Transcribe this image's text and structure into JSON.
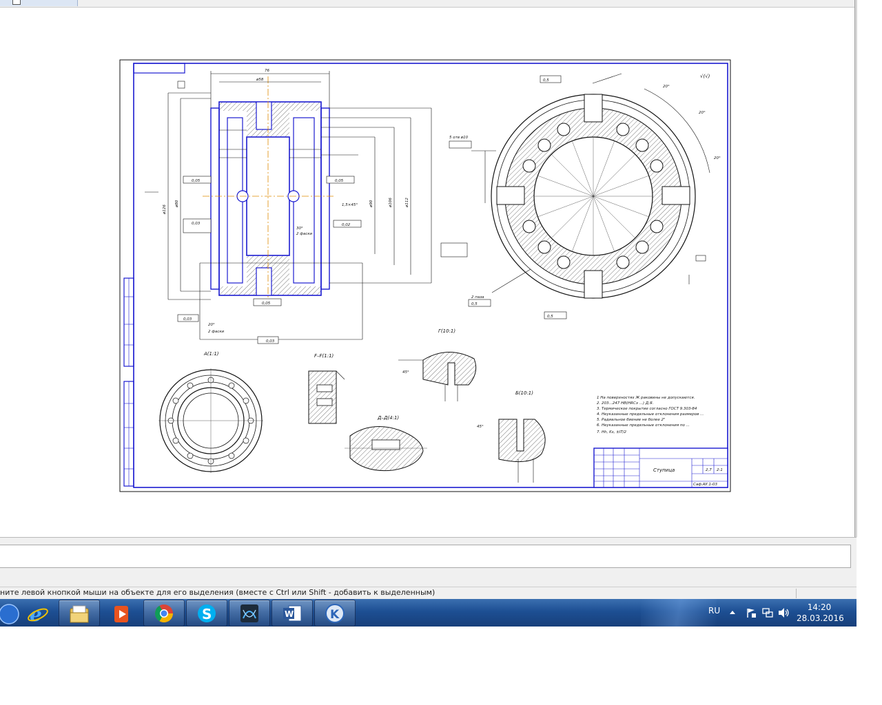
{
  "window": {
    "active_tab_icon": "document-icon"
  },
  "drawing": {
    "views": {
      "view_a": "А(1:1)",
      "section_f": "F–F(1:1)",
      "detail_g": "Г(10:1)",
      "section_d": "Д–Д(4:1)",
      "detail_b": "Б(10:1)",
      "roughness": "√(√)"
    },
    "notes": [
      "1 На поверхностях Ж раковины не допускаются.",
      "2. 203...247 НВ(НRCэ ...) Д.Я.",
      "3. Термическое покрытие согласно ГОСТ 9.303-84",
      "4. Неуказанные предельные отклонения размеров ...",
      "5. Радиальное биение не более 2\"",
      "6. Неуказанные предельные отклонения по ... ",
      "7. Hh, Ks, ±IT/2"
    ],
    "title_block": {
      "part_name": "Ступица",
      "designation": "Саф.АУ.1-03",
      "mass": "2,7",
      "scale": "2:1"
    },
    "dims": {
      "top_width": "76",
      "top_mid": "ø58",
      "d1": "ø126",
      "d2": "ø80",
      "d3": "ø90",
      "d4": "ø106",
      "d5": "ø112",
      "tol1": "0,05",
      "tol2": "0,03",
      "tol3": "0,02",
      "ang1": "20°",
      "ang2": "30°",
      "ang3": "45°",
      "pos1": "0,5",
      "pos2": "0,5",
      "pos3": "0,5",
      "holes": "5 отв ø10",
      "holes2": "2 паза",
      "chamfer": "1,5×45°",
      "grooves": "2 фаски"
    }
  },
  "status": {
    "message": "ните левой кнопкой мыши на объекте для его выделения (вместе с Ctrl или Shift - добавить к выделенным)"
  },
  "taskbar": {
    "apps": [
      "start-orb-icon",
      "internet-explorer-icon",
      "file-explorer-icon",
      "media-player-icon",
      "chrome-icon",
      "skype-icon",
      "3d-app-icon",
      "word-icon",
      "kompas-icon"
    ],
    "lang": "RU",
    "time": "14:20",
    "date": "28.03.2016"
  }
}
